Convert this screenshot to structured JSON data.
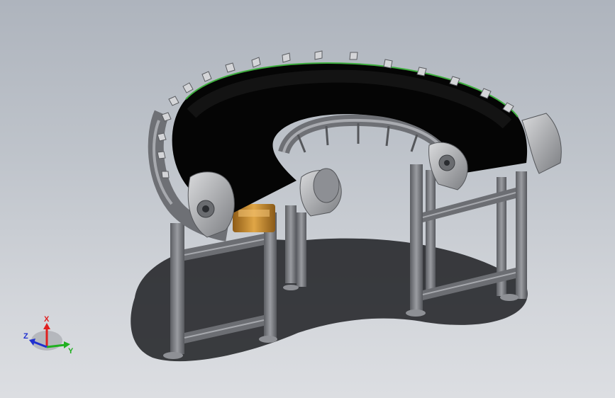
{
  "viewport": {
    "background_top": "#aeb4bd",
    "background_bottom": "#dcdee2"
  },
  "model": {
    "belt_color": "#050505",
    "belt_edge_color": "#3fae3f",
    "frame_color": "#7d7f84",
    "motor_color": "#c98a2c"
  },
  "triad": {
    "x_label": "X",
    "y_label": "Y",
    "z_label": "Z",
    "x_color": "#e02020",
    "y_color": "#20b020",
    "z_color": "#2030d0"
  }
}
